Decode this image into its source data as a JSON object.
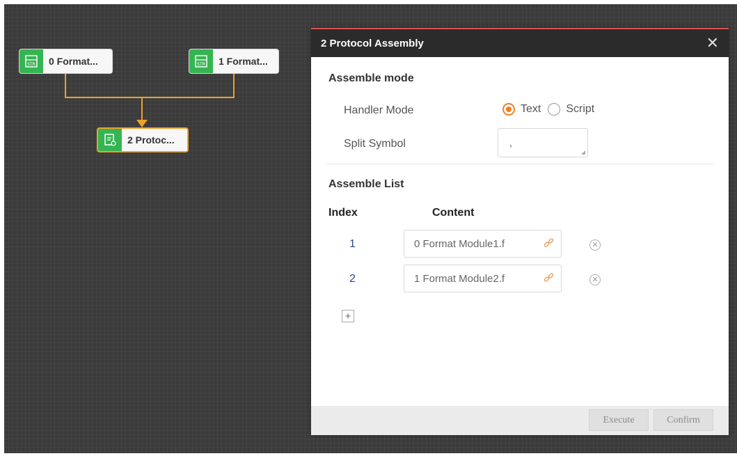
{
  "canvas": {
    "nodes": [
      {
        "label": "0 Format...",
        "icon": "format-str-icon"
      },
      {
        "label": "1 Format...",
        "icon": "format-str-icon"
      },
      {
        "label": "2 Protoc...",
        "icon": "protocol-assembly-icon"
      }
    ],
    "colors": {
      "wire": "#f0a028",
      "node_icon_bg": "#35b552"
    }
  },
  "dialog": {
    "title": "2 Protocol Assembly",
    "close_icon": "close-icon",
    "assemble_mode": {
      "title": "Assemble mode",
      "handler_mode_label": "Handler Mode",
      "handler_options": [
        "Text",
        "Script"
      ],
      "handler_selected": "Text",
      "split_symbol_label": "Split Symbol",
      "split_symbol_value": ","
    },
    "assemble_list": {
      "title": "Assemble List",
      "columns": [
        "Index",
        "Content"
      ],
      "rows": [
        {
          "index": "1",
          "content": "0 Format Module1.f"
        },
        {
          "index": "2",
          "content": "1 Format Module2.f"
        }
      ],
      "add_label": "+"
    },
    "footer": {
      "execute_label": "Execute",
      "confirm_label": "Confirm"
    },
    "colors": {
      "accent": "#f0801e",
      "header_bg": "#2b2b2b"
    }
  }
}
